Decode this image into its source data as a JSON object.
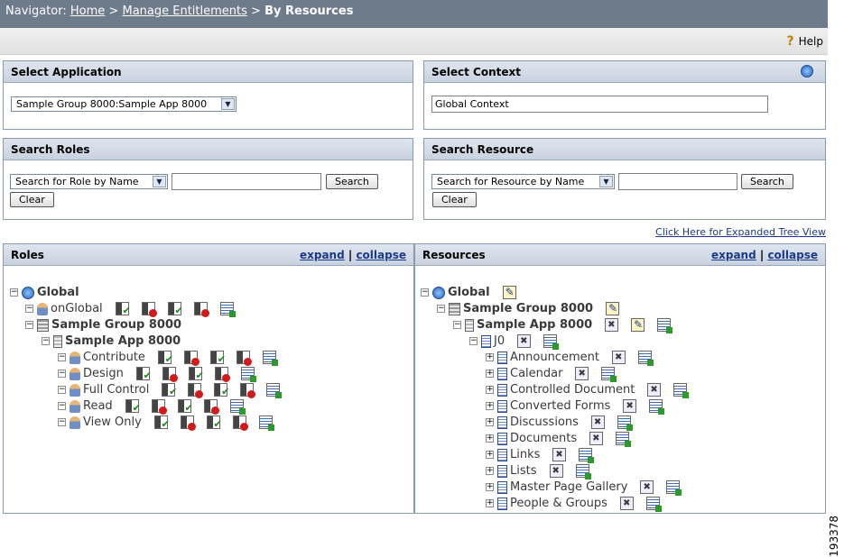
{
  "navigator": {
    "label": "Navigator:",
    "home": "Home",
    "manage": "Manage Entitlements",
    "current": "By Resources",
    "sep": ">"
  },
  "help": {
    "label": "Help"
  },
  "select_application": {
    "title": "Select Application",
    "selected": "Sample Group 8000:Sample App 8000"
  },
  "select_context": {
    "title": "Select Context",
    "value": "Global Context"
  },
  "search_roles": {
    "title": "Search Roles",
    "dropdown": "Search for Role by Name",
    "input_value": "",
    "search_btn": "Search",
    "clear_btn": "Clear"
  },
  "search_resource": {
    "title": "Search Resource",
    "dropdown": "Search for Resource by Name",
    "input_value": "",
    "search_btn": "Search",
    "clear_btn": "Clear"
  },
  "expanded_link": "Click Here for Expanded Tree View",
  "roles": {
    "title": "Roles",
    "expand": "expand",
    "collapse": "collapse",
    "sep": "|",
    "tree": {
      "global": "Global",
      "onglobal": "onGlobal",
      "group": "Sample Group 8000",
      "app": "Sample App 8000",
      "items": [
        "Contribute",
        "Design",
        "Full Control",
        "Read",
        "View Only"
      ]
    }
  },
  "resources": {
    "title": "Resources",
    "expand": "expand",
    "collapse": "collapse",
    "sep": "|",
    "tree": {
      "global": "Global",
      "group": "Sample Group 8000",
      "app": "Sample App 8000",
      "j0": "J0",
      "items": [
        "Announcement",
        "Calendar",
        "Controlled Document",
        "Converted Forms",
        "Discussions",
        "Documents",
        "Links",
        "Lists",
        "Master Page Gallery",
        "People & Groups"
      ]
    }
  },
  "figure_number": "193378"
}
